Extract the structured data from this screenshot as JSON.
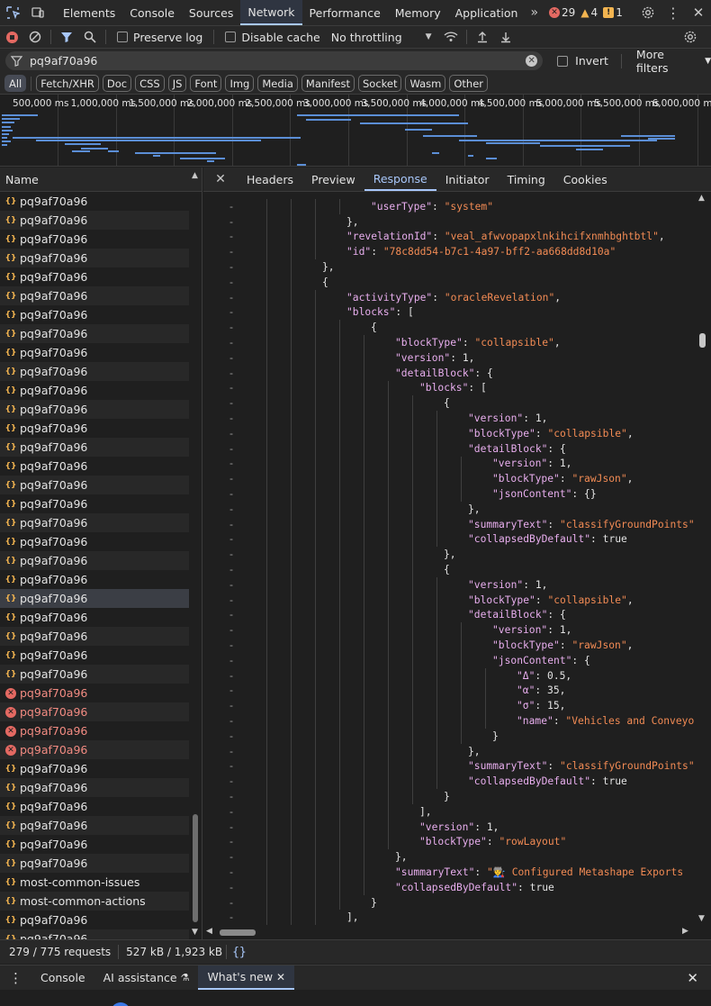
{
  "tabs": [
    {
      "label": "Elements"
    },
    {
      "label": "Console"
    },
    {
      "label": "Sources"
    },
    {
      "label": "Network"
    },
    {
      "label": "Performance"
    },
    {
      "label": "Memory"
    },
    {
      "label": "Application"
    }
  ],
  "issues": {
    "errors": "29",
    "warnings": "4",
    "info": "1"
  },
  "toolbar": {
    "preserve_log": "Preserve log",
    "disable_cache": "Disable cache",
    "throttling": "No throttling"
  },
  "filter": {
    "value": "pq9af70a96",
    "invert": "Invert",
    "more_filters": "More filters"
  },
  "types": [
    "All",
    "Fetch/XHR",
    "Doc",
    "CSS",
    "JS",
    "Font",
    "Img",
    "Media",
    "Manifest",
    "Socket",
    "Wasm",
    "Other"
  ],
  "timeline_ticks": [
    "500,000 ms",
    "1,000,000 ms",
    "1,500,000 ms",
    "2,000,000 ms",
    "2,500,000 ms",
    "3,000,000 ms",
    "3,500,000 ms",
    "4,000,000 ms",
    "4,500,000 ms",
    "5,000,000 ms",
    "5,500,000 ms",
    "6,000,000 ms"
  ],
  "requests": {
    "header": "Name",
    "rows": [
      {
        "name": "pq9af70a96",
        "status": "ok"
      },
      {
        "name": "pq9af70a96",
        "status": "ok"
      },
      {
        "name": "pq9af70a96",
        "status": "ok"
      },
      {
        "name": "pq9af70a96",
        "status": "ok"
      },
      {
        "name": "pq9af70a96",
        "status": "ok"
      },
      {
        "name": "pq9af70a96",
        "status": "ok"
      },
      {
        "name": "pq9af70a96",
        "status": "ok"
      },
      {
        "name": "pq9af70a96",
        "status": "ok"
      },
      {
        "name": "pq9af70a96",
        "status": "ok"
      },
      {
        "name": "pq9af70a96",
        "status": "ok"
      },
      {
        "name": "pq9af70a96",
        "status": "ok"
      },
      {
        "name": "pq9af70a96",
        "status": "ok"
      },
      {
        "name": "pq9af70a96",
        "status": "ok"
      },
      {
        "name": "pq9af70a96",
        "status": "ok"
      },
      {
        "name": "pq9af70a96",
        "status": "ok"
      },
      {
        "name": "pq9af70a96",
        "status": "ok"
      },
      {
        "name": "pq9af70a96",
        "status": "ok"
      },
      {
        "name": "pq9af70a96",
        "status": "ok"
      },
      {
        "name": "pq9af70a96",
        "status": "ok"
      },
      {
        "name": "pq9af70a96",
        "status": "ok"
      },
      {
        "name": "pq9af70a96",
        "status": "ok"
      },
      {
        "name": "pq9af70a96",
        "status": "selected"
      },
      {
        "name": "pq9af70a96",
        "status": "ok"
      },
      {
        "name": "pq9af70a96",
        "status": "ok"
      },
      {
        "name": "pq9af70a96",
        "status": "ok"
      },
      {
        "name": "pq9af70a96",
        "status": "ok"
      },
      {
        "name": "pq9af70a96",
        "status": "error"
      },
      {
        "name": "pq9af70a96",
        "status": "error"
      },
      {
        "name": "pq9af70a96",
        "status": "error"
      },
      {
        "name": "pq9af70a96",
        "status": "error"
      },
      {
        "name": "pq9af70a96",
        "status": "ok"
      },
      {
        "name": "pq9af70a96",
        "status": "ok"
      },
      {
        "name": "pq9af70a96",
        "status": "ok"
      },
      {
        "name": "pq9af70a96",
        "status": "ok"
      },
      {
        "name": "pq9af70a96",
        "status": "ok"
      },
      {
        "name": "pq9af70a96",
        "status": "ok"
      },
      {
        "name": "most-common-issues",
        "status": "ok"
      },
      {
        "name": "most-common-actions",
        "status": "ok"
      },
      {
        "name": "pq9af70a96",
        "status": "ok"
      },
      {
        "name": "pq9af70a96",
        "status": "ok"
      }
    ]
  },
  "detail_tabs": [
    "Headers",
    "Preview",
    "Response",
    "Initiator",
    "Timing",
    "Cookies"
  ],
  "response_lines": [
    {
      "d": 7,
      "t": [
        [
          "k",
          "\"userType\""
        ],
        [
          "p",
          ": "
        ],
        [
          "s",
          "\"system\""
        ]
      ]
    },
    {
      "d": 6,
      "t": [
        [
          "p",
          "},"
        ]
      ]
    },
    {
      "d": 6,
      "t": [
        [
          "k",
          "\"revelationId\""
        ],
        [
          "p",
          ": "
        ],
        [
          "s",
          "\"veal_afwvopapxlnkihcifxnmhbghtbtl\""
        ],
        [
          "p",
          ","
        ]
      ]
    },
    {
      "d": 6,
      "t": [
        [
          "k",
          "\"id\""
        ],
        [
          "p",
          ": "
        ],
        [
          "s",
          "\"78c8dd54-b7c1-4a97-bff2-aa668dd8d10a\""
        ]
      ]
    },
    {
      "d": 5,
      "t": [
        [
          "p",
          "},"
        ]
      ]
    },
    {
      "d": 5,
      "t": [
        [
          "p",
          "{"
        ]
      ]
    },
    {
      "d": 6,
      "t": [
        [
          "k",
          "\"activityType\""
        ],
        [
          "p",
          ": "
        ],
        [
          "s",
          "\"oracleRevelation\""
        ],
        [
          "p",
          ","
        ]
      ]
    },
    {
      "d": 6,
      "t": [
        [
          "k",
          "\"blocks\""
        ],
        [
          "p",
          ": ["
        ]
      ]
    },
    {
      "d": 7,
      "t": [
        [
          "p",
          "{"
        ]
      ]
    },
    {
      "d": 8,
      "t": [
        [
          "k",
          "\"blockType\""
        ],
        [
          "p",
          ": "
        ],
        [
          "s",
          "\"collapsible\""
        ],
        [
          "p",
          ","
        ]
      ]
    },
    {
      "d": 8,
      "t": [
        [
          "k",
          "\"version\""
        ],
        [
          "p",
          ": "
        ],
        [
          "n",
          "1"
        ],
        [
          "p",
          ","
        ]
      ]
    },
    {
      "d": 8,
      "t": [
        [
          "k",
          "\"detailBlock\""
        ],
        [
          "p",
          ": {"
        ]
      ]
    },
    {
      "d": 9,
      "t": [
        [
          "k",
          "\"blocks\""
        ],
        [
          "p",
          ": ["
        ]
      ]
    },
    {
      "d": 10,
      "t": [
        [
          "p",
          "{"
        ]
      ]
    },
    {
      "d": 11,
      "t": [
        [
          "k",
          "\"version\""
        ],
        [
          "p",
          ": "
        ],
        [
          "n",
          "1"
        ],
        [
          "p",
          ","
        ]
      ]
    },
    {
      "d": 11,
      "t": [
        [
          "k",
          "\"blockType\""
        ],
        [
          "p",
          ": "
        ],
        [
          "s",
          "\"collapsible\""
        ],
        [
          "p",
          ","
        ]
      ]
    },
    {
      "d": 11,
      "t": [
        [
          "k",
          "\"detailBlock\""
        ],
        [
          "p",
          ": {"
        ]
      ]
    },
    {
      "d": 12,
      "t": [
        [
          "k",
          "\"version\""
        ],
        [
          "p",
          ": "
        ],
        [
          "n",
          "1"
        ],
        [
          "p",
          ","
        ]
      ]
    },
    {
      "d": 12,
      "t": [
        [
          "k",
          "\"blockType\""
        ],
        [
          "p",
          ": "
        ],
        [
          "s",
          "\"rawJson\""
        ],
        [
          "p",
          ","
        ]
      ]
    },
    {
      "d": 12,
      "t": [
        [
          "k",
          "\"jsonContent\""
        ],
        [
          "p",
          ": {}"
        ]
      ]
    },
    {
      "d": 11,
      "t": [
        [
          "p",
          "},"
        ]
      ]
    },
    {
      "d": 11,
      "t": [
        [
          "k",
          "\"summaryText\""
        ],
        [
          "p",
          ": "
        ],
        [
          "s",
          "\"classifyGroundPoints\""
        ]
      ]
    },
    {
      "d": 11,
      "t": [
        [
          "k",
          "\"collapsedByDefault\""
        ],
        [
          "p",
          ": "
        ],
        [
          "n",
          "true"
        ]
      ]
    },
    {
      "d": 10,
      "t": [
        [
          "p",
          "},"
        ]
      ]
    },
    {
      "d": 10,
      "t": [
        [
          "p",
          "{"
        ]
      ]
    },
    {
      "d": 11,
      "t": [
        [
          "k",
          "\"version\""
        ],
        [
          "p",
          ": "
        ],
        [
          "n",
          "1"
        ],
        [
          "p",
          ","
        ]
      ]
    },
    {
      "d": 11,
      "t": [
        [
          "k",
          "\"blockType\""
        ],
        [
          "p",
          ": "
        ],
        [
          "s",
          "\"collapsible\""
        ],
        [
          "p",
          ","
        ]
      ]
    },
    {
      "d": 11,
      "t": [
        [
          "k",
          "\"detailBlock\""
        ],
        [
          "p",
          ": {"
        ]
      ]
    },
    {
      "d": 12,
      "t": [
        [
          "k",
          "\"version\""
        ],
        [
          "p",
          ": "
        ],
        [
          "n",
          "1"
        ],
        [
          "p",
          ","
        ]
      ]
    },
    {
      "d": 12,
      "t": [
        [
          "k",
          "\"blockType\""
        ],
        [
          "p",
          ": "
        ],
        [
          "s",
          "\"rawJson\""
        ],
        [
          "p",
          ","
        ]
      ]
    },
    {
      "d": 12,
      "t": [
        [
          "k",
          "\"jsonContent\""
        ],
        [
          "p",
          ": {"
        ]
      ]
    },
    {
      "d": 13,
      "t": [
        [
          "k",
          "\"Δ\""
        ],
        [
          "p",
          ": "
        ],
        [
          "n",
          "0.5"
        ],
        [
          "p",
          ","
        ]
      ]
    },
    {
      "d": 13,
      "t": [
        [
          "k",
          "\"α\""
        ],
        [
          "p",
          ": "
        ],
        [
          "n",
          "35"
        ],
        [
          "p",
          ","
        ]
      ]
    },
    {
      "d": 13,
      "t": [
        [
          "k",
          "\"σ\""
        ],
        [
          "p",
          ": "
        ],
        [
          "n",
          "15"
        ],
        [
          "p",
          ","
        ]
      ]
    },
    {
      "d": 13,
      "t": [
        [
          "k",
          "\"name\""
        ],
        [
          "p",
          ": "
        ],
        [
          "s",
          "\"Vehicles and Conveyo"
        ]
      ]
    },
    {
      "d": 12,
      "t": [
        [
          "p",
          "}"
        ]
      ]
    },
    {
      "d": 11,
      "t": [
        [
          "p",
          "},"
        ]
      ]
    },
    {
      "d": 11,
      "t": [
        [
          "k",
          "\"summaryText\""
        ],
        [
          "p",
          ": "
        ],
        [
          "s",
          "\"classifyGroundPoints\""
        ]
      ]
    },
    {
      "d": 11,
      "t": [
        [
          "k",
          "\"collapsedByDefault\""
        ],
        [
          "p",
          ": "
        ],
        [
          "n",
          "true"
        ]
      ]
    },
    {
      "d": 10,
      "t": [
        [
          "p",
          "}"
        ]
      ]
    },
    {
      "d": 9,
      "t": [
        [
          "p",
          "],"
        ]
      ]
    },
    {
      "d": 9,
      "t": [
        [
          "k",
          "\"version\""
        ],
        [
          "p",
          ": "
        ],
        [
          "n",
          "1"
        ],
        [
          "p",
          ","
        ]
      ]
    },
    {
      "d": 9,
      "t": [
        [
          "k",
          "\"blockType\""
        ],
        [
          "p",
          ": "
        ],
        [
          "s",
          "\"rowLayout\""
        ]
      ]
    },
    {
      "d": 8,
      "t": [
        [
          "p",
          "},"
        ]
      ]
    },
    {
      "d": 8,
      "t": [
        [
          "k",
          "\"summaryText\""
        ],
        [
          "p",
          ": "
        ],
        [
          "s",
          "\"👨‍🏭 Configured Metashape Exports"
        ]
      ]
    },
    {
      "d": 8,
      "t": [
        [
          "k",
          "\"collapsedByDefault\""
        ],
        [
          "p",
          ": "
        ],
        [
          "n",
          "true"
        ]
      ]
    },
    {
      "d": 7,
      "t": [
        [
          "p",
          "}"
        ]
      ]
    },
    {
      "d": 6,
      "t": [
        [
          "p",
          "],"
        ]
      ]
    }
  ],
  "status": {
    "requests": "279 / 775 requests",
    "transferred": "527 kB / 1,923 kB"
  },
  "drawer_tabs": [
    {
      "label": "Console"
    },
    {
      "label": "AI assistance"
    },
    {
      "label": "What's new"
    }
  ],
  "colors": {
    "accent": "#a8c7fa",
    "error": "#e46962",
    "json_key": "#e8aeee",
    "json_string": "#f28b54"
  }
}
